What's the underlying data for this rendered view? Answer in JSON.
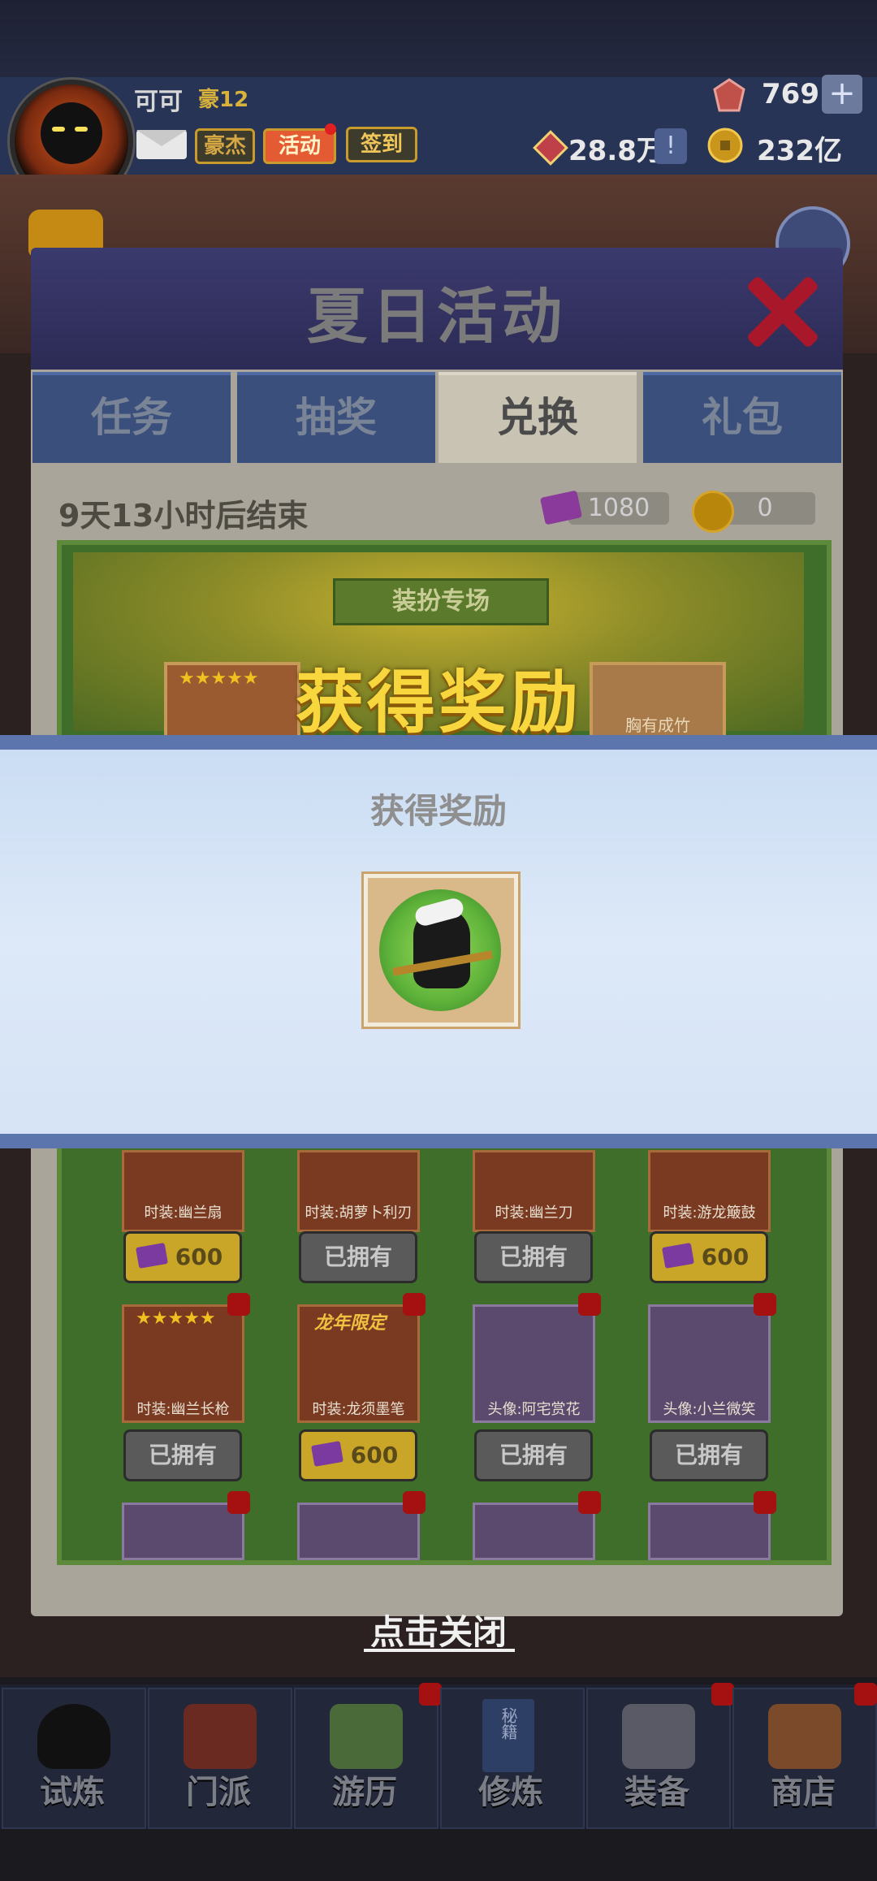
{
  "player": {
    "name": "可可",
    "vip": "豪12",
    "buttons": [
      "豪杰",
      "活动",
      "签到"
    ]
  },
  "resources": {
    "gems": "769",
    "power": "28.8万",
    "gold": "232亿"
  },
  "event": {
    "title": "夏日活动",
    "tabs": [
      "任务",
      "抽奖",
      "兑换",
      "礼包"
    ],
    "active_tab": "兑换",
    "ends_in": "9天13小时后结束",
    "tickets": "1080",
    "coins": "0",
    "section_banner": "装扮专场",
    "top_card_right": "胸有成竹"
  },
  "reward_popup": {
    "banner_title": "获得奖励",
    "title": "获得奖励",
    "close_hint": "点击关闭"
  },
  "items": [
    {
      "label": "时装:幽兰扇",
      "button": "600",
      "owned": false
    },
    {
      "label": "时装:胡萝卜利刃",
      "button": "已拥有",
      "owned": true
    },
    {
      "label": "时装:幽兰刀",
      "button": "已拥有",
      "owned": true
    },
    {
      "label": "时装:游龙簸鼓",
      "button": "600",
      "owned": false
    },
    {
      "label": "时装:幽兰长枪",
      "button": "已拥有",
      "owned": true
    },
    {
      "label": "时装:龙须墨笔",
      "button": "600",
      "owned": false,
      "tag": "龙年限定"
    },
    {
      "label": "头像:阿宅赏花",
      "button": "已拥有",
      "owned": true
    },
    {
      "label": "头像:小兰微笑",
      "button": "已拥有",
      "owned": true
    }
  ],
  "nav": [
    {
      "label": "试炼",
      "icon": "ninja-icon"
    },
    {
      "label": "门派",
      "icon": "temple-icon"
    },
    {
      "label": "游历",
      "icon": "mountain-icon"
    },
    {
      "label": "修炼",
      "icon": "scroll-icon",
      "icon_text": "秘籍"
    },
    {
      "label": "装备",
      "icon": "sword-icon"
    },
    {
      "label": "商店",
      "icon": "shop-icon"
    }
  ],
  "colors": {
    "title_gold": "#f8d73e",
    "overlay_bg": "#d5e3f5",
    "tab_active": "#c9c3b4",
    "tab_inactive": "#3a4f7c"
  }
}
